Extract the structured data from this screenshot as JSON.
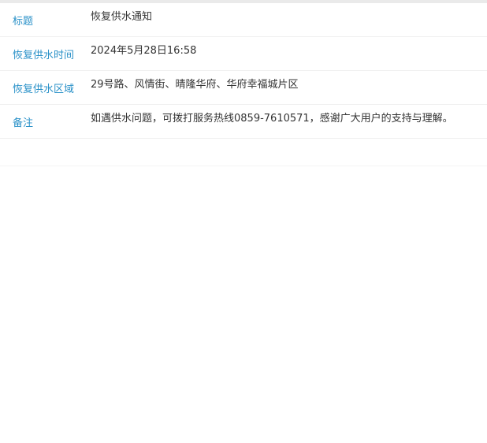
{
  "notice": {
    "rows": [
      {
        "label": "标题",
        "value": "恢复供水通知"
      },
      {
        "label": "恢复供水时间",
        "value": "2024年5月28日16:58"
      },
      {
        "label": "恢复供水区域",
        "value": "29号路、风情街、晴隆华府、华府幸福城片区"
      },
      {
        "label": "备注",
        "value": "如遇供水问题，可拨打服务热线0859-7610571，感谢广大用户的支持与理解。"
      }
    ]
  },
  "colors": {
    "label": "#2a91c8",
    "value": "#333333",
    "divider": "#f0f0f0"
  }
}
